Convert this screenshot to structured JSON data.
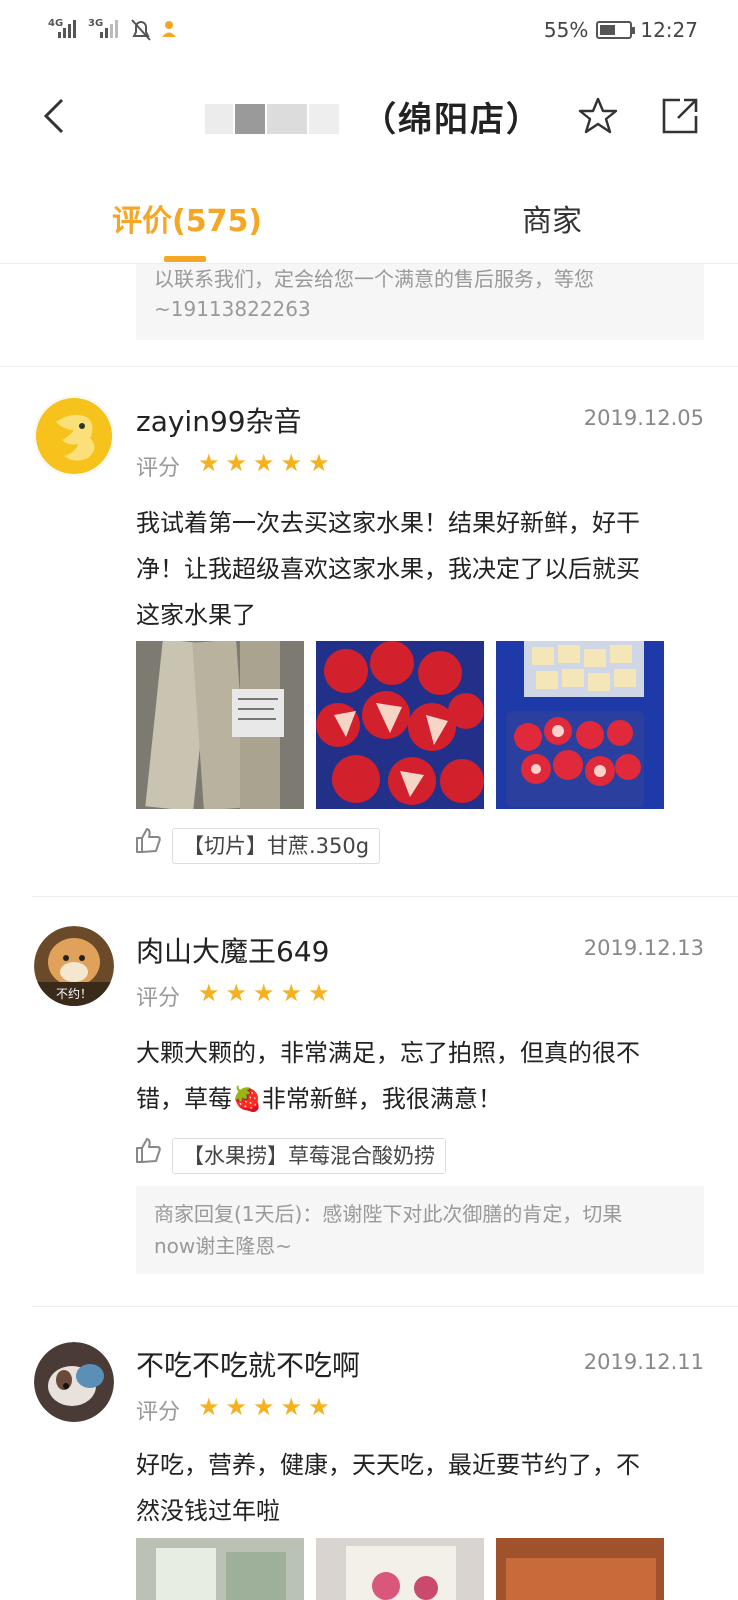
{
  "status_bar": {
    "signal_1": "4G",
    "signal_2": "3G",
    "battery": "55%",
    "battery_level": 0.55,
    "time": "12:27",
    "icons": [
      "signal-icon",
      "signal-icon",
      "mute-bell-icon",
      "notification-icon",
      "battery-icon"
    ]
  },
  "header": {
    "title": "（绵阳店）",
    "back_icon": "back-arrow-icon",
    "favorite_icon": "star-outline-icon",
    "share_icon": "share-icon"
  },
  "tabs": [
    {
      "label": "评价(575)",
      "active": true
    },
    {
      "label": "商家",
      "active": false
    }
  ],
  "prev_reply": {
    "line1": "以联系我们，定会给您一个满意的售后服务，等您",
    "line2": "~19113822263"
  },
  "reviews": [
    {
      "username": "zayin99杂音",
      "date": "2019.12.05",
      "rating_label": "评分",
      "stars": 5,
      "content_lines": [
        "我试着第一次去买这家水果！结果好新鲜，好干",
        "净！让我超级喜欢这家水果，我决定了以后就买",
        "这家水果了"
      ],
      "tag": "【切片】甘蔗.350g"
    },
    {
      "username": "肉山大魔王649",
      "date": "2019.12.13",
      "rating_label": "评分",
      "stars": 5,
      "content_lines": [
        "大颗大颗的，非常满足，忘了拍照，但真的很不",
        "错，草莓🍓非常新鲜，我很满意！"
      ],
      "tag": "【水果捞】草莓混合酸奶捞",
      "reply_lines": [
        "商家回复(1天后)：感谢陛下对此次御膳的肯定，切果",
        "now谢主隆恩~"
      ],
      "avatar_text": "不约！"
    },
    {
      "username": "不吃不吃就不吃啊",
      "date": "2019.12.11",
      "rating_label": "评分",
      "stars": 5,
      "content_lines": [
        "好吃，营养，健康，天天吃，最近要节约了，不",
        "然没钱过年啦"
      ]
    }
  ],
  "colors": {
    "accent": "#f5a623",
    "star": "#f5b11f",
    "reply_bg": "#f6f6f6"
  }
}
